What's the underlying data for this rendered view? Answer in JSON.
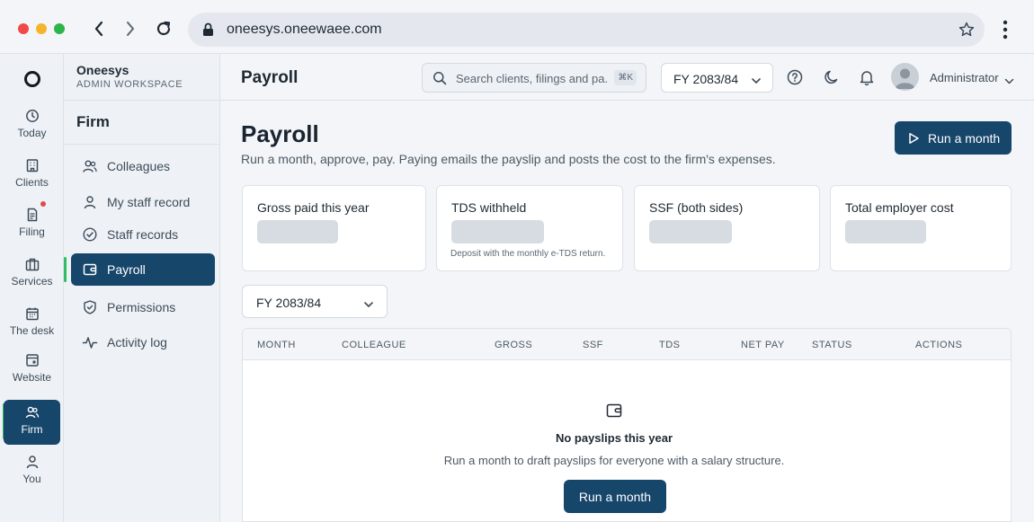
{
  "browser": {
    "url": "oneesys.oneewaee.com"
  },
  "rail": {
    "items": [
      {
        "label": "Today",
        "icon": "clock-icon"
      },
      {
        "label": "Clients",
        "icon": "building-icon"
      },
      {
        "label": "Filing",
        "icon": "document-icon"
      },
      {
        "label": "Services",
        "icon": "briefcase-icon"
      },
      {
        "label": "The desk",
        "icon": "calendar-icon"
      },
      {
        "label": "Website",
        "icon": "browser-icon"
      },
      {
        "label": "Firm",
        "icon": "users-icon"
      },
      {
        "label": "You",
        "icon": "user-icon"
      }
    ],
    "active": "Firm"
  },
  "sidebar": {
    "workspace_name": "Oneesys",
    "workspace_sub": "ADMIN WORKSPACE",
    "section_title": "Firm",
    "items": [
      {
        "label": "Colleagues",
        "icon": "users-icon"
      },
      {
        "label": "My staff record",
        "icon": "user-icon"
      },
      {
        "label": "Staff records",
        "icon": "check-circle-icon"
      },
      {
        "label": "Payroll",
        "icon": "wallet-icon"
      },
      {
        "label": "Permissions",
        "icon": "shield-icon"
      },
      {
        "label": "Activity log",
        "icon": "activity-icon"
      }
    ],
    "active": "Payroll"
  },
  "topbar": {
    "title": "Payroll",
    "search_placeholder": "Search clients, filings and pa...",
    "shortcut": "⌘K",
    "fiscal_year": "FY 2083/84",
    "user_name": "Administrator"
  },
  "page": {
    "title": "Payroll",
    "subtitle": "Run a month, approve, pay. Paying emails the payslip and posts the cost to the firm's expenses.",
    "run_button": "Run a month"
  },
  "cards": [
    {
      "label": "Gross paid this year",
      "note": ""
    },
    {
      "label": "TDS withheld",
      "note": "Deposit with the monthly e-TDS return."
    },
    {
      "label": "SSF (both sides)",
      "note": ""
    },
    {
      "label": "Total employer cost",
      "note": ""
    }
  ],
  "filter": {
    "fiscal_year": "FY 2083/84"
  },
  "table": {
    "columns": [
      "MONTH",
      "COLLEAGUE",
      "GROSS",
      "SSF",
      "TDS",
      "NET PAY",
      "STATUS",
      "ACTIONS"
    ],
    "empty_title": "No payslips this year",
    "empty_subtitle": "Run a month to draft payslips for everyone with a salary structure.",
    "empty_button": "Run a month"
  },
  "colors": {
    "primary": "#17466b",
    "active_indicator": "#2fbf61",
    "notification_dot": "#e5484d"
  }
}
